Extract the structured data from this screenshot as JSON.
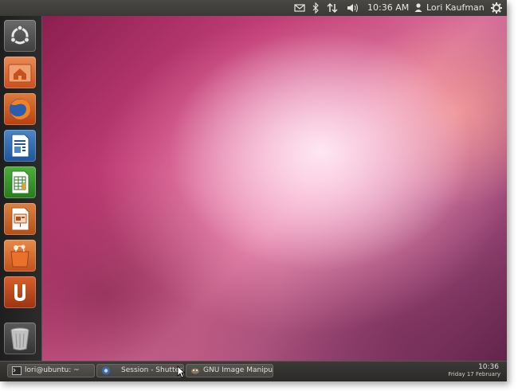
{
  "top_panel": {
    "time": "10:36 AM",
    "user": "Lori Kaufman",
    "icons": [
      "mail-icon",
      "bluetooth-icon",
      "network-icon",
      "volume-icon",
      "user-icon",
      "session-gear-icon"
    ]
  },
  "launcher": {
    "items": [
      {
        "name": "dash-home",
        "icon": "ubuntu-logo-icon"
      },
      {
        "name": "home-folder",
        "icon": "home-folder-icon"
      },
      {
        "name": "firefox",
        "icon": "firefox-icon"
      },
      {
        "name": "libreoffice-writer",
        "icon": "writer-icon"
      },
      {
        "name": "libreoffice-calc",
        "icon": "calc-icon"
      },
      {
        "name": "libreoffice-impress",
        "icon": "impress-icon"
      },
      {
        "name": "software-center",
        "icon": "shopping-bag-icon"
      },
      {
        "name": "ubuntu-one",
        "icon": "ubuntu-one-icon"
      },
      {
        "name": "trash",
        "icon": "trash-icon"
      }
    ]
  },
  "taskbar": {
    "tasks": [
      {
        "label": "lori@ubuntu: ~",
        "icon": "terminal-icon"
      },
      {
        "label": "Session - Shutter",
        "icon": "shutter-icon"
      },
      {
        "label": "GNU Image Manipul...",
        "icon": "gimp-icon"
      }
    ],
    "clock_time": "10:36",
    "clock_date": "Friday 17 February"
  },
  "colors": {
    "panel": "#3c3b37",
    "accent_orange": "#e0662a",
    "wallpaper_base": "#c23f77"
  }
}
